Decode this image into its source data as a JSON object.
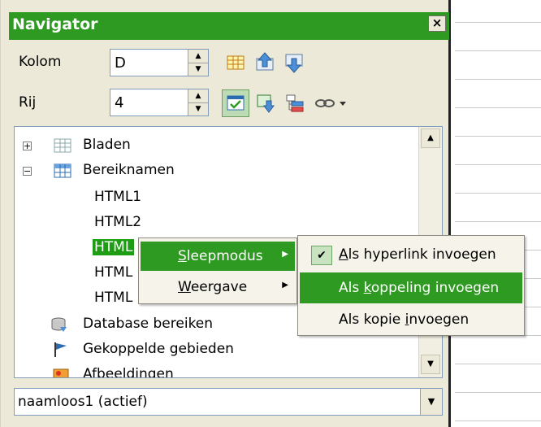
{
  "navigator": {
    "title": "Navigator",
    "close_label": "×",
    "column_label": "Kolom",
    "column_value": "D",
    "row_label": "Rij",
    "row_value": "4"
  },
  "tree": {
    "items": [
      {
        "label": "Bladen",
        "expander": "+"
      },
      {
        "label": "Bereiknamen",
        "expander": "−"
      },
      {
        "label": "HTML1"
      },
      {
        "label": "HTML2"
      },
      {
        "label": "HTML"
      },
      {
        "label": "HTML"
      },
      {
        "label": "HTML"
      },
      {
        "label": "Database bereiken"
      },
      {
        "label": "Gekoppelde gebieden"
      },
      {
        "label": "Afbeeldingen"
      }
    ]
  },
  "document_combo": {
    "value": "naamloos1 (actief)"
  },
  "context_menu": {
    "drag_mode": {
      "pre": "",
      "ul": "S",
      "post": "leepmodus"
    },
    "display": {
      "pre": "",
      "ul": "W",
      "post": "eergave"
    }
  },
  "submenu": {
    "hyperlink": {
      "pre": "",
      "ul": "A",
      "post": "ls hyperlink invoegen"
    },
    "link": {
      "pre": "Als ",
      "ul": "k",
      "post": "oppeling invoegen"
    },
    "copy": {
      "pre": "Als kopie ",
      "ul": "i",
      "post": "nvoegen"
    },
    "check_mark": "✔"
  },
  "colors": {
    "accent": "#2e9a21",
    "selection": "#1e9d14",
    "panel_bg": "#ece9d8"
  },
  "icons": {
    "toolbar": [
      "table-toggle-icon",
      "move-up-icon",
      "move-down-icon",
      "contents-view-icon",
      "promote-icon",
      "scenarios-icon",
      "link-icon"
    ]
  }
}
